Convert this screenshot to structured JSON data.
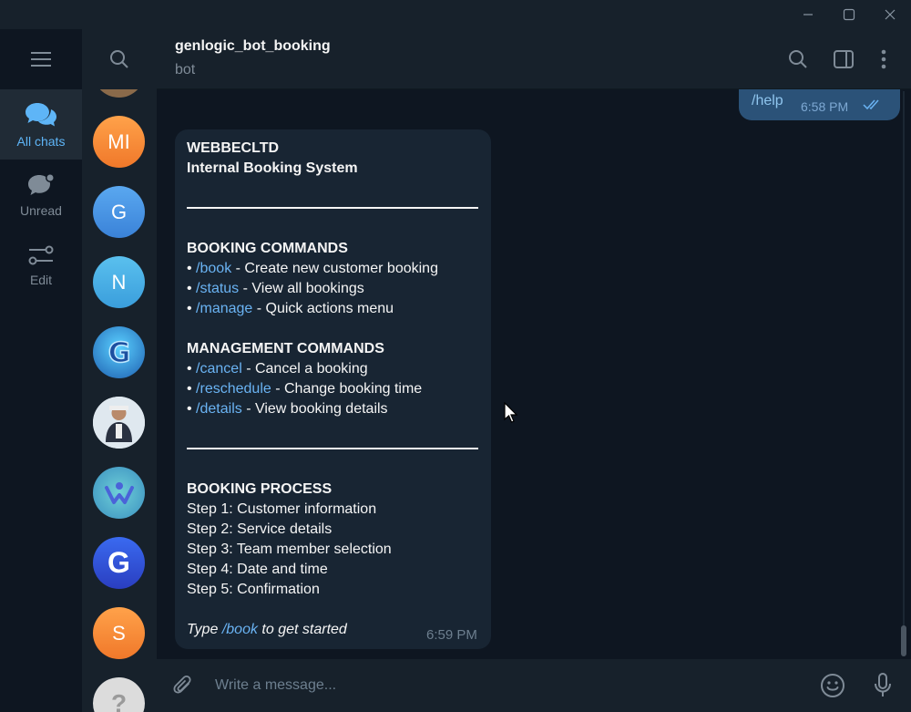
{
  "window": {
    "min_label": "—",
    "max_label": "☐",
    "close_label": "✕"
  },
  "folders": {
    "items": [
      {
        "label": "All chats",
        "icon": "chats-icon",
        "active": true
      },
      {
        "label": "Unread",
        "icon": "unread-chat-icon",
        "active": false
      },
      {
        "label": "Edit",
        "icon": "edit-sliders-icon",
        "active": false
      }
    ]
  },
  "avatars": [
    {
      "text": "",
      "color": "#8a6a4a"
    },
    {
      "text": "MI",
      "color": "#f5892f"
    },
    {
      "text": "G",
      "color": "#3e8ee0"
    },
    {
      "text": "N",
      "color": "#3ba3e0"
    },
    {
      "text": "G",
      "color": "#2f7ac9"
    },
    {
      "text": "",
      "color": "#5aa0d8"
    },
    {
      "text": "",
      "color": "#3aa6c8"
    },
    {
      "text": "G",
      "color": "#2f4fd0"
    },
    {
      "text": "S",
      "color": "#f08a2a"
    },
    {
      "text": "?",
      "color": "#d8d8d8"
    }
  ],
  "header": {
    "title": "genlogic_bot_booking",
    "status": "bot"
  },
  "messages": {
    "outgoing": {
      "text": "/help",
      "time": "6:58 PM"
    },
    "incoming": {
      "line1": "WEBBECLTD",
      "line2": "Internal Booking System",
      "section1": "BOOKING COMMANDS",
      "book_cmd": "/book",
      "book_desc": " - Create new customer booking",
      "status_cmd": "/status",
      "status_desc": " - View all bookings",
      "manage_cmd": "/manage",
      "manage_desc": " - Quick actions menu",
      "section2": "MANAGEMENT COMMANDS",
      "cancel_cmd": "/cancel",
      "cancel_desc": " - Cancel a booking",
      "resched_cmd": "/reschedule",
      "resched_desc": " - Change booking time",
      "details_cmd": "/details",
      "details_desc": " - View booking details",
      "section3": "BOOKING PROCESS",
      "step1": "Step 1: Customer information",
      "step2": "Step 2: Service details",
      "step3": "Step 3: Team member selection",
      "step4": "Step 4: Date and time",
      "step5": "Step 5: Confirmation",
      "footer_pre": "Type ",
      "footer_cmd": "/book",
      "footer_post": " to get started",
      "time": "6:59 PM"
    }
  },
  "composer": {
    "placeholder": "Write a message..."
  },
  "colors": {
    "accent": "#5eb5f7",
    "link": "#6ab3f3",
    "outgoing_bubble": "#2b5278",
    "incoming_bubble": "#182533"
  }
}
